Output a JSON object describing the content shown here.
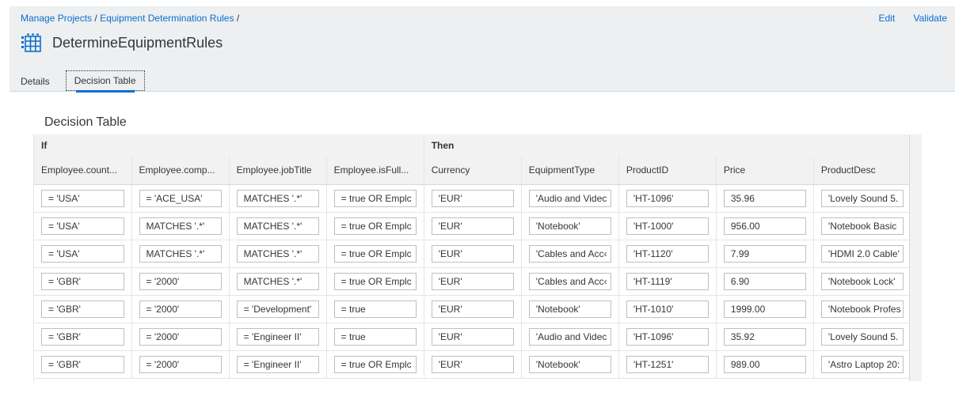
{
  "breadcrumb": {
    "item1": "Manage Projects",
    "sep1": " / ",
    "item2": "Equipment Determination Rules",
    "sep2": " /"
  },
  "actions": {
    "edit": "Edit",
    "validate": "Validate"
  },
  "title": "DetermineEquipmentRules",
  "tabs": {
    "details": "Details",
    "decision_table": "Decision Table"
  },
  "section_title": "Decision Table",
  "table": {
    "group_if": "If",
    "group_then": "Then",
    "columns": [
      "Employee.count...",
      "Employee.comp...",
      "Employee.jobTitle",
      "Employee.isFull...",
      "Currency",
      "EquipmentType",
      "ProductID",
      "Price",
      "ProductDesc"
    ],
    "rows": [
      [
        "= 'USA'",
        "= 'ACE_USA'",
        "MATCHES '.*'",
        "= true OR Emplc",
        "'EUR'",
        "'Audio and Videc",
        "'HT-1096'",
        "35.96",
        "'Lovely Sound 5."
      ],
      [
        "= 'USA'",
        "MATCHES '.*'",
        "MATCHES '.*'",
        "= true OR Emplc",
        "'EUR'",
        "'Notebook'",
        "'HT-1000'",
        "956.00",
        "'Notebook Basic"
      ],
      [
        "= 'USA'",
        "MATCHES '.*'",
        "MATCHES '.*'",
        "= true OR Emplc",
        "'EUR'",
        "'Cables and Acc‹",
        "'HT-1120'",
        "7.99",
        "'HDMI 2.0 Cable'"
      ],
      [
        "= 'GBR'",
        "= '2000'",
        "MATCHES '.*'",
        "= true OR Emplc",
        "'EUR'",
        "'Cables and Acc‹",
        "'HT-1119'",
        "6.90",
        "'Notebook Lock'"
      ],
      [
        "= 'GBR'",
        "= '2000'",
        "= 'Development'",
        "= true",
        "'EUR'",
        "'Notebook'",
        "'HT-1010'",
        "1999.00",
        "'Notebook Profes"
      ],
      [
        "= 'GBR'",
        "= '2000'",
        "= 'Engineer II'",
        "= true",
        "'EUR'",
        "'Audio and Videc",
        "'HT-1096'",
        "35.92",
        "'Lovely Sound 5."
      ],
      [
        "= 'GBR'",
        "= '2000'",
        "= 'Engineer II'",
        "= true OR Emplc",
        "'EUR'",
        "'Notebook'",
        "'HT-1251'",
        "989.00",
        "'Astro Laptop 20:"
      ]
    ]
  },
  "colors": {
    "accent": "#0a6ed1",
    "header_bg": "#edeff0",
    "table_header_bg": "#f2f2f2"
  },
  "icons": {
    "title_icon": "decision-table-icon"
  }
}
